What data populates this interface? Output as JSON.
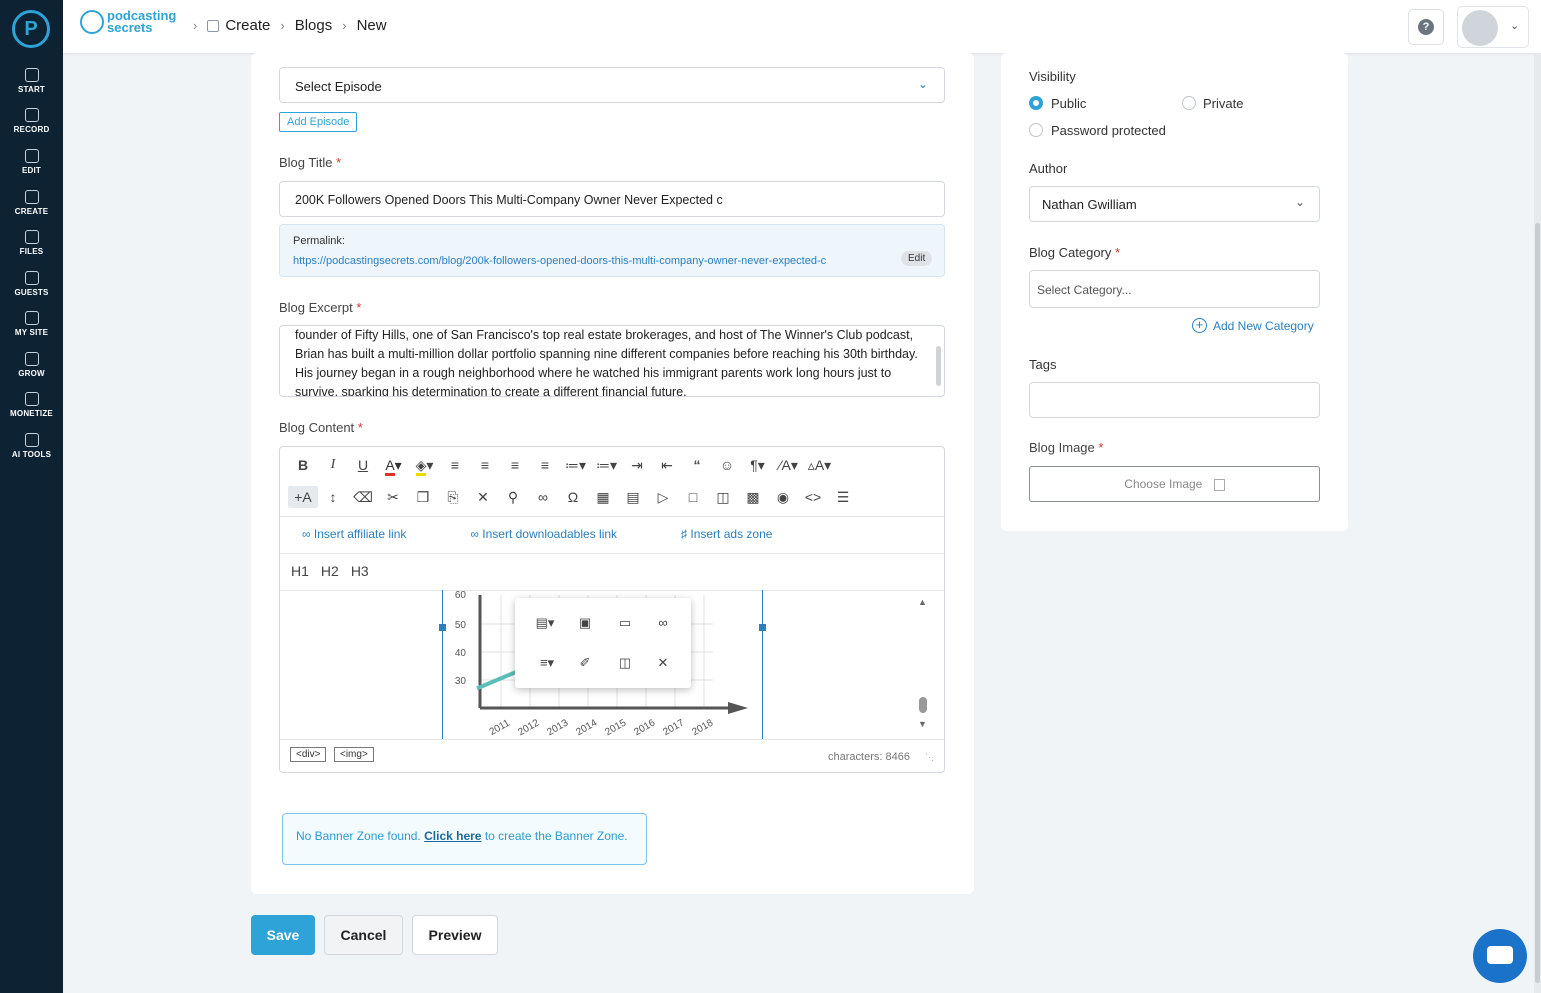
{
  "nav": {
    "items": [
      {
        "label": "START",
        "icon": "start-icon"
      },
      {
        "label": "RECORD",
        "icon": "mic-icon"
      },
      {
        "label": "EDIT",
        "icon": "edit-icon"
      },
      {
        "label": "CREATE",
        "icon": "create-icon"
      },
      {
        "label": "FILES",
        "icon": "files-icon"
      },
      {
        "label": "GUESTS",
        "icon": "guests-icon"
      },
      {
        "label": "MY SITE",
        "icon": "site-icon"
      },
      {
        "label": "GROW",
        "icon": "grow-icon"
      },
      {
        "label": "MONETIZE",
        "icon": "monetize-icon"
      },
      {
        "label": "AI TOOLS",
        "icon": "ai-icon"
      }
    ]
  },
  "topbar": {
    "logo_line1": "podcasting",
    "logo_line2": "secrets",
    "crumbs": [
      "Create",
      "Blogs",
      "New"
    ]
  },
  "form": {
    "episode_placeholder": "Select Episode",
    "add_episode": "Add Episode",
    "title_label": "Blog Title",
    "title_value": "200K Followers Opened Doors  This Multi-Company Owner Never Expected c",
    "permalink_label": "Permalink:",
    "permalink_url": "https://podcastingsecrets.com/blog/200k-followers-opened-doors-this-multi-company-owner-never-expected-c",
    "permalink_edit": "Edit",
    "excerpt_label": "Blog Excerpt",
    "excerpt_text": "founder of Fifty Hills, one of San Francisco's top real estate brokerages, and host of The Winner's Club podcast, Brian has built a multi-million dollar portfolio spanning nine different companies before reaching his 30th birthday. His journey began in a rough neighborhood where he watched his immigrant parents work long hours just to survive, sparking his determination to create a different financial future.",
    "content_label": "Blog Content",
    "required_mark": "*"
  },
  "editor": {
    "plugins": [
      "Insert affiliate link",
      "Insert downloadables link",
      "Insert ads zone"
    ],
    "headings": [
      "H1",
      "H2",
      "H3"
    ],
    "path_tags": [
      "<div>",
      "<img>"
    ],
    "characters": "characters: 8466"
  },
  "chart_data": {
    "type": "line",
    "x": [
      "2011",
      "2012",
      "2013",
      "2014",
      "2015",
      "2016",
      "2017",
      "2018"
    ],
    "y_ticks": [
      30,
      40,
      50
    ],
    "y_partial_tick": "60",
    "series": [
      {
        "values": [
          27,
          33
        ]
      }
    ]
  },
  "banner": {
    "text_before": "No Banner Zone found.",
    "link": "Click here",
    "text_after": "to create the Banner Zone."
  },
  "actions": {
    "save": "Save",
    "cancel": "Cancel",
    "preview": "Preview"
  },
  "sidebar": {
    "visibility_label": "Visibility",
    "vis_public": "Public",
    "vis_private": "Private",
    "vis_password": "Password protected",
    "author_label": "Author",
    "author_value": "Nathan Gwilliam",
    "category_label": "Blog Category",
    "category_placeholder": "Select Category...",
    "add_category": "Add New Category",
    "tags_label": "Tags",
    "image_label": "Blog Image",
    "choose_image": "Choose Image"
  },
  "colors": {
    "accent": "#2ea3d8",
    "nav_bg": "#0d2233",
    "required": "#d9342b",
    "link": "#2a7fc0"
  }
}
